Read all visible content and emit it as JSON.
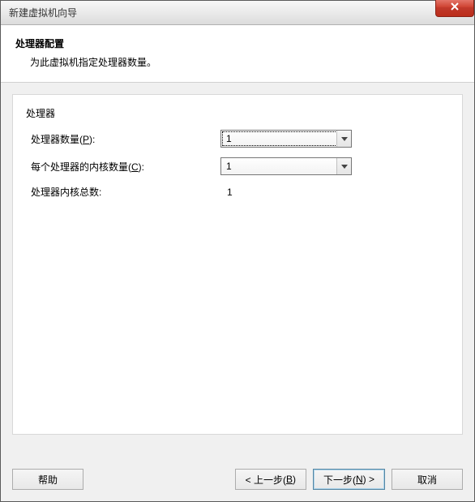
{
  "window": {
    "title": "新建虚拟机向导"
  },
  "header": {
    "title": "处理器配置",
    "subtitle": "为此虚拟机指定处理器数量。"
  },
  "group": {
    "label": "处理器",
    "processor_count": {
      "label_prefix": "处理器数量(",
      "hotkey": "P",
      "label_suffix": "):",
      "value": "1"
    },
    "cores_per_processor": {
      "label_prefix": "每个处理器的内核数量(",
      "hotkey": "C",
      "label_suffix": "):",
      "value": "1"
    },
    "total_cores": {
      "label": "处理器内核总数:",
      "value": "1"
    }
  },
  "buttons": {
    "help": "帮助",
    "back_prefix": "< 上一步(",
    "back_hotkey": "B",
    "back_suffix": ")",
    "next_prefix": "下一步(",
    "next_hotkey": "N",
    "next_suffix": ") >",
    "cancel": "取消"
  }
}
